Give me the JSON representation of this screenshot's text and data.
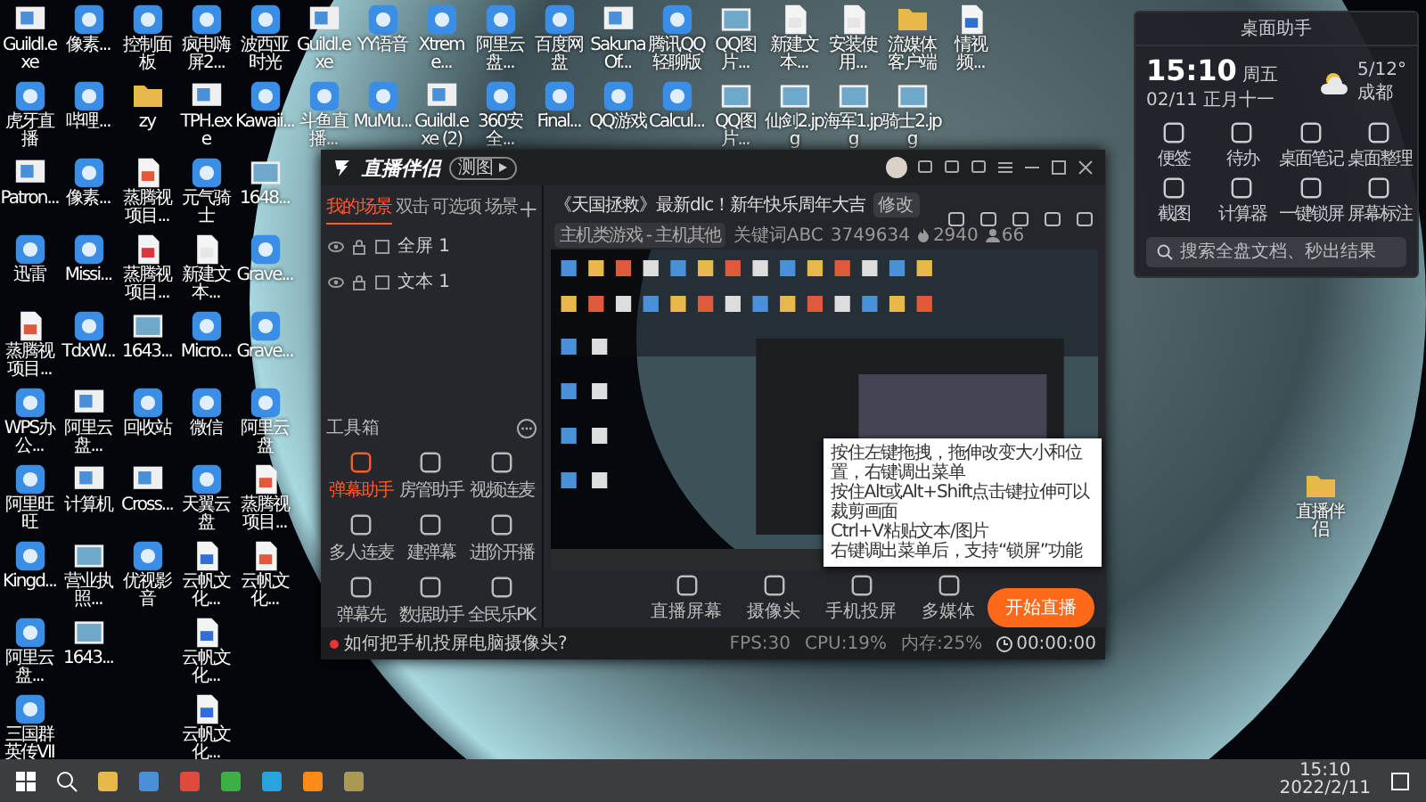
{
  "desktop": {
    "top_rows": [
      [
        {
          "label": "Guildl.exe",
          "kind": "exe"
        },
        {
          "label": "像素...",
          "kind": "app"
        },
        {
          "label": "控制面板",
          "kind": "app"
        },
        {
          "label": "疯电嗨屏2...",
          "kind": "app"
        },
        {
          "label": "波西亚时光",
          "kind": "app"
        },
        {
          "label": "Guildl.exe",
          "kind": "exe"
        },
        {
          "label": "YY语音",
          "kind": "app"
        },
        {
          "label": "Xtreme...",
          "kind": "app"
        },
        {
          "label": "阿里云盘...",
          "kind": "app"
        },
        {
          "label": "百度网盘",
          "kind": "app"
        },
        {
          "label": "Sakuna Of...",
          "kind": "exe"
        },
        {
          "label": "腾讯QQ轻聊版",
          "kind": "app"
        },
        {
          "label": "QQ图片...",
          "kind": "image"
        },
        {
          "label": "新建文本...",
          "kind": "txt"
        },
        {
          "label": "安装使用...",
          "kind": "txt"
        },
        {
          "label": "流媒体客户端",
          "kind": "folder"
        },
        {
          "label": "情视频...",
          "kind": "doc"
        }
      ],
      [
        {
          "label": "虎牙直播",
          "kind": "app"
        },
        {
          "label": "哔哩...",
          "kind": "app"
        },
        {
          "label": "zy",
          "kind": "folder"
        },
        {
          "label": "TPH.exe",
          "kind": "exe"
        },
        {
          "label": "Kawaii...",
          "kind": "app"
        },
        {
          "label": "斗鱼直播...",
          "kind": "app"
        },
        {
          "label": "MuMu...",
          "kind": "app"
        },
        {
          "label": "Guildl.exe (2)",
          "kind": "exe"
        },
        {
          "label": "360安全...",
          "kind": "app"
        },
        {
          "label": "Final...",
          "kind": "app"
        },
        {
          "label": "QQ游戏",
          "kind": "app"
        },
        {
          "label": "Calcul...",
          "kind": "app"
        },
        {
          "label": "QQ图片...",
          "kind": "image"
        },
        {
          "label": "仙剑2.jpg",
          "kind": "image"
        },
        {
          "label": "海军1.jpg",
          "kind": "image"
        },
        {
          "label": "骑士2.jpg",
          "kind": "image"
        }
      ]
    ],
    "left_columns": [
      [
        {
          "label": "Patron...",
          "kind": "exe"
        },
        {
          "label": "迅雷",
          "kind": "app"
        },
        {
          "label": "蒸腾视项目...",
          "kind": "ppt"
        },
        {
          "label": "WPS办公...",
          "kind": "app"
        },
        {
          "label": "阿里旺旺",
          "kind": "app"
        },
        {
          "label": "Kingd...",
          "kind": "app"
        },
        {
          "label": "阿里云盘...",
          "kind": "app"
        },
        {
          "label": "三国群英传VII",
          "kind": "app"
        }
      ],
      [
        {
          "label": "像素...",
          "kind": "app"
        },
        {
          "label": "Missi...",
          "kind": "app"
        },
        {
          "label": "TdxW...",
          "kind": "app"
        },
        {
          "label": "阿里云盘...",
          "kind": "exe"
        },
        {
          "label": "计算机",
          "kind": "exe"
        },
        {
          "label": "营业执照...",
          "kind": "image"
        },
        {
          "label": "1643...",
          "kind": "image"
        }
      ],
      [
        {
          "label": "蒸腾视项目...",
          "kind": "ppt"
        },
        {
          "label": "蒸腾视项目...",
          "kind": "pdf"
        },
        {
          "label": "1643...",
          "kind": "image"
        },
        {
          "label": "回收站",
          "kind": "app"
        },
        {
          "label": "Cross...",
          "kind": "exe"
        },
        {
          "label": "优视影音",
          "kind": "app"
        }
      ],
      [
        {
          "label": "元气骑士",
          "kind": "app"
        },
        {
          "label": "新建文本...",
          "kind": "txt"
        },
        {
          "label": "Micro...",
          "kind": "app"
        },
        {
          "label": "微信",
          "kind": "app"
        },
        {
          "label": "天翼云盘",
          "kind": "app"
        },
        {
          "label": "云帆文化...",
          "kind": "doc"
        },
        {
          "label": "云帆文化...",
          "kind": "doc"
        },
        {
          "label": "云帆文化...",
          "kind": "doc"
        }
      ],
      [
        {
          "label": "1648...",
          "kind": "image"
        },
        {
          "label": "Grave...",
          "kind": "app"
        },
        {
          "label": "Grave...",
          "kind": "app"
        },
        {
          "label": "阿里云盘",
          "kind": "app"
        },
        {
          "label": "蒸腾视项目...",
          "kind": "ppt"
        },
        {
          "label": "云帆文化...",
          "kind": "ppt"
        }
      ]
    ],
    "folder": {
      "label": "直播伴侣"
    }
  },
  "app": {
    "logo": "直播伴侣",
    "badge": "测图",
    "scene_tabs": [
      {
        "label": "我的场景",
        "selected": true
      },
      {
        "label": "双击",
        "selected": false
      },
      {
        "label": "可选项",
        "selected": false
      },
      {
        "label": "场景",
        "selected": false
      }
    ],
    "sources": [
      {
        "label": "全屏 1"
      },
      {
        "label": "文本 1"
      }
    ],
    "toolbox_title": "工具箱",
    "tools": [
      {
        "label": "弹幕助手",
        "selected": true
      },
      {
        "label": "房管助手",
        "selected": false
      },
      {
        "label": "视频连麦",
        "selected": false
      },
      {
        "label": "多人连麦",
        "selected": false
      },
      {
        "label": "建弹幕",
        "selected": false
      },
      {
        "label": "进阶开播",
        "selected": false
      },
      {
        "label": "弹幕先",
        "selected": false
      },
      {
        "label": "数据助手",
        "selected": false
      },
      {
        "label": "全民乐PK",
        "selected": false
      }
    ],
    "stream_title": "《天国拯救》最新dlc！新年快乐周年大吉",
    "edit_tag": "修改",
    "category": "主机类游戏 - 主机其他",
    "stats": [
      {
        "kind": "text",
        "value": "关键词ABC"
      },
      {
        "kind": "text",
        "value": "3749634"
      },
      {
        "kind": "fire",
        "value": "2940"
      },
      {
        "kind": "person",
        "value": "66"
      }
    ],
    "actions": [
      {
        "label": "直播屏幕"
      },
      {
        "label": "摄像头"
      },
      {
        "label": "手机投屏"
      },
      {
        "label": "多媒体"
      }
    ],
    "start_button": "开始直播",
    "tooltip_lines": [
      "按住左键拖拽，拖伸改变大小和位置，右键调出菜单",
      "按住Alt或Alt+Shift点击键拉伸可以裁剪画面",
      "Ctrl+V粘贴文本/图片",
      "右键调出菜单后，支持“锁屏”功能"
    ],
    "status_tip": "如何把手机投屏电脑摄像头?",
    "status_items": [
      "FPS:30",
      "CPU:19%",
      "内存:25%"
    ],
    "timer": "00:00:00"
  },
  "widget": {
    "title": "桌面助手",
    "time": "15:10",
    "weekday": "周五",
    "date": "02/11",
    "lunar": "正月十一",
    "temp": "5/12°",
    "city": "成都",
    "tools": [
      "便签",
      "待办",
      "桌面笔记",
      "桌面整理",
      "截图",
      "计算器",
      "一键锁屏",
      "屏幕标注"
    ],
    "search": {
      "placeholder": "搜索全盘文档、秒出结果"
    }
  },
  "taskbar": {
    "time": "15:10",
    "date": "2022/2/11"
  }
}
